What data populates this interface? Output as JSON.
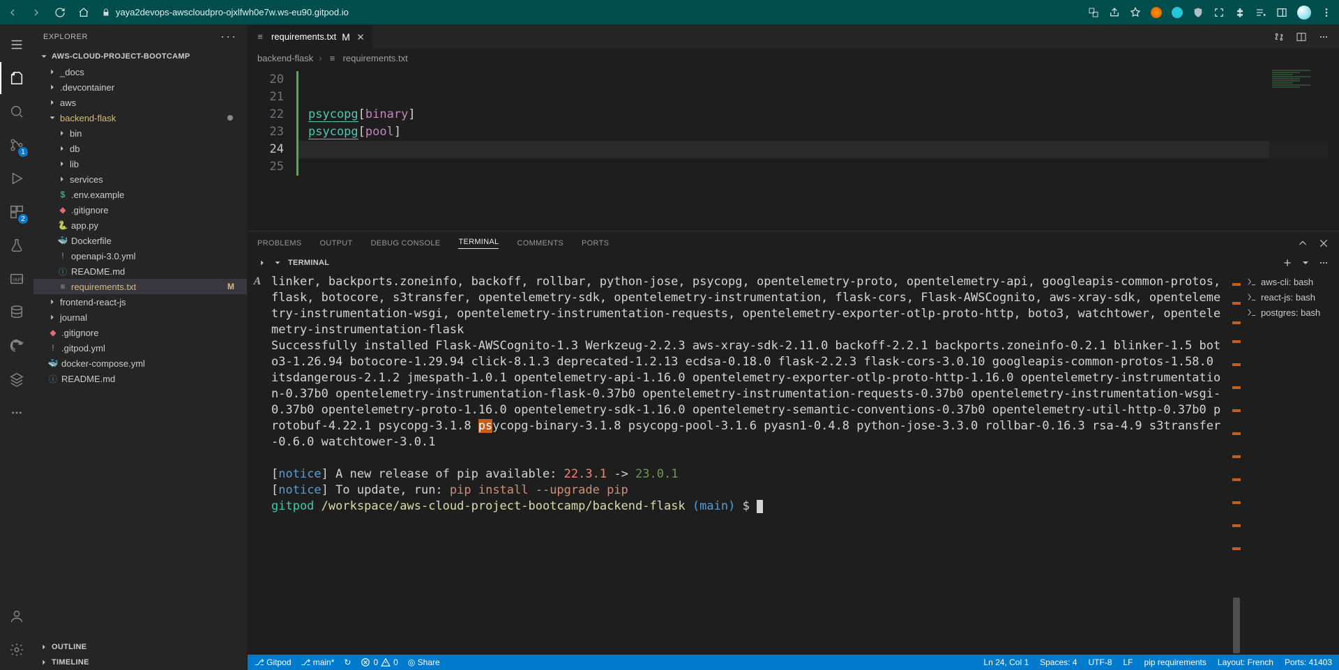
{
  "browser": {
    "url_host": "yaya2devops-awscloudpro-ojxlfwh0e7w.ws-eu90.gitpod.io"
  },
  "activity_badges": {
    "scm": "1",
    "run": "2"
  },
  "explorer": {
    "title": "EXPLORER",
    "project": "AWS-CLOUD-PROJECT-BOOTCAMP",
    "folders_root": [
      {
        "name": "_docs"
      },
      {
        "name": ".devcontainer"
      },
      {
        "name": "aws"
      }
    ],
    "backend_flask": {
      "name": "backend-flask",
      "children_folders": [
        {
          "name": "bin"
        },
        {
          "name": "db"
        },
        {
          "name": "lib"
        },
        {
          "name": "services"
        }
      ],
      "children_files": [
        {
          "name": ".env.example",
          "icon": "dollar",
          "color": "#4ec9b0"
        },
        {
          "name": ".gitignore",
          "icon": "git",
          "color": "#e06c75"
        },
        {
          "name": "app.py",
          "icon": "python",
          "color": "#4b8bbe"
        },
        {
          "name": "Dockerfile",
          "icon": "docker",
          "color": "#2496ed"
        },
        {
          "name": "openapi-3.0.yml",
          "icon": "excl",
          "color": "#c678dd"
        },
        {
          "name": "README.md",
          "icon": "info",
          "color": "#519aba"
        },
        {
          "name": "requirements.txt",
          "icon": "lines",
          "color": "#a0a0a0",
          "selected": true,
          "modified": "M"
        }
      ]
    },
    "after_backend": [
      {
        "name": "frontend-react-js",
        "type": "folder"
      },
      {
        "name": "journal",
        "type": "folder"
      },
      {
        "name": ".gitignore",
        "type": "file",
        "icon": "git",
        "color": "#e06c75"
      },
      {
        "name": ".gitpod.yml",
        "type": "file",
        "icon": "excl",
        "color": "#c678dd"
      },
      {
        "name": "docker-compose.yml",
        "type": "file",
        "icon": "docker",
        "color": "#f06292"
      },
      {
        "name": "README.md",
        "type": "file",
        "icon": "info",
        "color": "#519aba"
      }
    ],
    "outline": "OUTLINE",
    "timeline": "TIMELINE"
  },
  "tabs": {
    "open": {
      "label": "requirements.txt",
      "modified": "M"
    }
  },
  "breadcrumb": {
    "segments": [
      "backend-flask",
      "requirements.txt"
    ]
  },
  "editor": {
    "lines": [
      {
        "num": "20",
        "text": ""
      },
      {
        "num": "21",
        "text": ""
      },
      {
        "num": "22",
        "pkg": "psycopg",
        "key": "binary"
      },
      {
        "num": "23",
        "pkg": "psycopg",
        "key": "pool"
      },
      {
        "num": "24",
        "text": "",
        "current": true
      },
      {
        "num": "25",
        "text": ""
      }
    ]
  },
  "panel_tabs": {
    "problems": "PROBLEMS",
    "output": "OUTPUT",
    "debug": "DEBUG CONSOLE",
    "terminal": "TERMINAL",
    "comments": "COMMENTS",
    "ports": "PORTS"
  },
  "terminal": {
    "header": "TERMINAL",
    "shells": [
      {
        "label": "aws-cli: bash"
      },
      {
        "label": "react-js: bash"
      },
      {
        "label": "postgres: bash"
      }
    ],
    "output_line1": "linker, backports.zoneinfo, backoff, rollbar, python-jose, psycopg, opentelemetry-proto, opentelemetry-api, googleapis-common-protos, flask, botocore, s3transfer, opentelemetry-sdk, opentelemetry-instrumentation, flask-cors, Flask-AWSCognito, aws-xray-sdk, opentelemetry-instrumentation-wsgi, opentelemetry-instrumentation-requests, opentelemetry-exporter-otlp-proto-http, boto3, watchtower, opentelemetry-instrumentation-flask",
    "output_line2": "Successfully installed Flask-AWSCognito-1.3 Werkzeug-2.2.3 aws-xray-sdk-2.11.0 backoff-2.2.1 backports.zoneinfo-0.2.1 blinker-1.5 boto3-1.26.94 botocore-1.29.94 click-8.1.3 deprecated-1.2.13 ecdsa-0.18.0 flask-2.2.3 flask-cors-3.0.10 googleapis-common-protos-1.58.0 itsdangerous-2.1.2 jmespath-1.0.1 opentelemetry-api-1.16.0 opentelemetry-exporter-otlp-proto-http-1.16.0 opentelemetry-instrumentation-0.37b0 opentelemetry-instrumentation-flask-0.37b0 opentelemetry-instrumentation-requests-0.37b0 opentelemetry-instrumentation-wsgi-0.37b0 opentelemetry-proto-1.16.0 opentelemetry-sdk-1.16.0 opentelemetry-semantic-conventions-0.37b0 opentelemetry-util-http-0.37b0 protobuf-4.22.1 psycopg-3.1.8 ",
    "output_psy_hl": "ps",
    "output_line2b": "ycopg-binary-3.1.8 psycopg-pool-3.1.6 pyasn1-0.4.8 python-jose-3.3.0 rollbar-0.16.3 rsa-4.9 s3transfer-0.6.0 watchtower-3.0.1",
    "notice1a": "[",
    "notice1b": "notice",
    "notice1c": "] A new release of pip available: ",
    "notice1_old": "22.3.1",
    "notice1_arrow": " -> ",
    "notice1_new": "23.0.1",
    "notice2a": "[",
    "notice2b": "notice",
    "notice2c": "] To update, run: ",
    "notice2_cmd": "pip install --upgrade pip",
    "prompt_user": "gitpod",
    "prompt_path": "/workspace/aws-cloud-project-bootcamp/backend-flask",
    "prompt_branch": "(main)",
    "prompt_dollar": "$"
  },
  "status": {
    "gitpod": "Gitpod",
    "branch": "main*",
    "sync": "↻",
    "err": "0",
    "warn": "0",
    "share": "Share",
    "ln": "Ln 24, Col 1",
    "spaces": "Spaces: 4",
    "enc": "UTF-8",
    "eol": "LF",
    "lang": "pip requirements",
    "layout": "Layout: French",
    "ports": "Ports: 41403"
  }
}
